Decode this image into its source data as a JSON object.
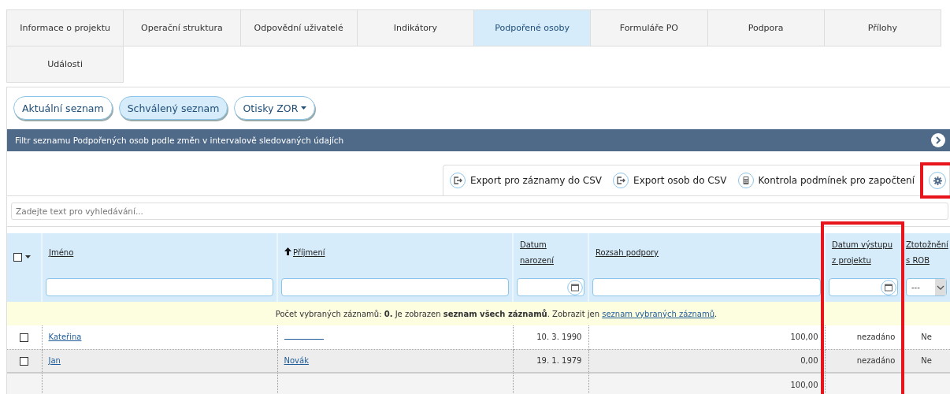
{
  "tabs": [
    {
      "label": "Informace o projektu",
      "selected": false
    },
    {
      "label": "Operační struktura",
      "selected": false
    },
    {
      "label": "Odpovědní uživatelé",
      "selected": false
    },
    {
      "label": "Indikátory",
      "selected": false
    },
    {
      "label": "Podpořené osoby",
      "selected": true
    },
    {
      "label": "Formuláře PO",
      "selected": false
    },
    {
      "label": "Podpora",
      "selected": false
    },
    {
      "label": "Přílohy",
      "selected": false
    },
    {
      "label": "Události",
      "selected": false
    }
  ],
  "list_buttons": [
    {
      "label": "Aktuální seznam",
      "selected": false,
      "kind": "button"
    },
    {
      "label": "Schválený seznam",
      "selected": true,
      "kind": "button"
    },
    {
      "label": "Otisky ZOR",
      "selected": false,
      "kind": "dropdown"
    }
  ],
  "filter_bar": {
    "title": "Filtr seznamu Podpořených osob podle změn v intervalově sledovaných údajích",
    "expanded": false
  },
  "actions": [
    {
      "label": "Export pro záznamy do CSV",
      "kind": "export"
    },
    {
      "label": "Export osob do CSV",
      "kind": "export"
    },
    {
      "label": "Kontrola podmínek pro započtení",
      "kind": "calculator"
    }
  ],
  "settings": {
    "highlighted": true
  },
  "search": {
    "placeholder": "Zadejte text pro vyhledávání..."
  },
  "table": {
    "select_all_checked": false,
    "columns": [
      {
        "label": "Jméno",
        "sorted": false,
        "kind": "text",
        "highlighted": false
      },
      {
        "label": "Příjmení",
        "sorted": true,
        "kind": "text",
        "highlighted": false
      },
      {
        "label": "Datum narození",
        "sorted": false,
        "kind": "date",
        "highlighted": false
      },
      {
        "label": "Rozsah podpory",
        "sorted": false,
        "kind": "number",
        "highlighted": false,
        "total": "100,00"
      },
      {
        "label": "Datum výstupu z projektu",
        "sorted": false,
        "kind": "date",
        "highlighted": true
      },
      {
        "label": "Ztotožnění s ROB",
        "sorted": false,
        "kind": "select",
        "filter_value": "---",
        "highlighted": false
      }
    ],
    "info": {
      "text": "Počet vybraných záznamů: **0.** Je zobrazen **seznam všech záznamů**. Zobrazit jen",
      "link": "seznam vybraných záznamů",
      "after": "."
    },
    "rows": [
      {
        "checked": false,
        "cells": [
          {
            "text": "Kateřina",
            "link": true
          },
          {
            "link": true
          },
          {
            "text": "10. 3. 1990"
          },
          {
            "text": "100,00"
          },
          {
            "text": "nezadáno"
          },
          {
            "text": "Ne"
          }
        ]
      },
      {
        "checked": false,
        "cells": [
          {
            "text": "Jan",
            "link": true
          },
          {
            "text": "Novák",
            "link": true
          },
          {
            "text": "19. 1. 1979"
          },
          {
            "text": "0,00"
          },
          {
            "text": "nezadáno"
          },
          {
            "text": "Ne"
          }
        ]
      }
    ]
  }
}
